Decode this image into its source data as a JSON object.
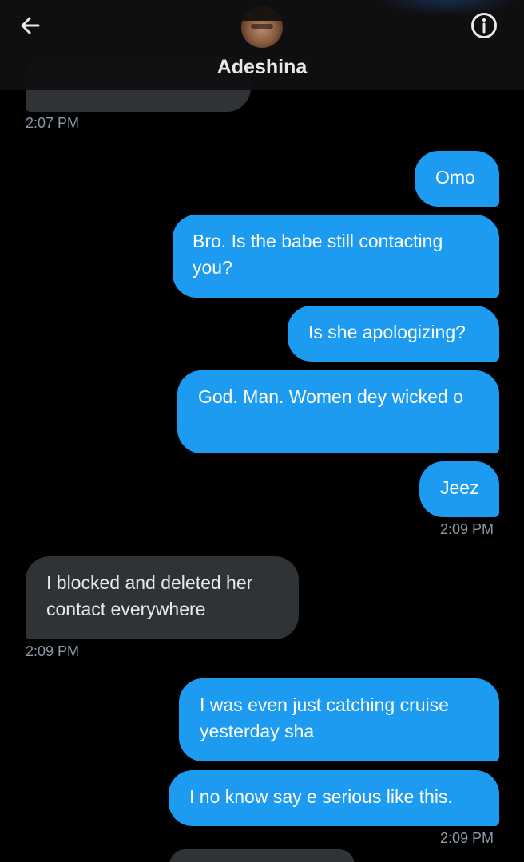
{
  "header": {
    "contact_name": "Adeshina",
    "back_icon": "arrow-left-icon",
    "info_icon": "info-icon"
  },
  "colors": {
    "outgoing_bubble": "#1d9bf0",
    "incoming_bubble": "#2f3336",
    "timestamp": "#8b98a5",
    "background": "#000000"
  },
  "messages": [
    {
      "direction": "in",
      "text": "",
      "partial": true
    },
    {
      "direction": "out",
      "text": "Omo"
    },
    {
      "direction": "out",
      "text": "Bro. Is the babe still contacting you?"
    },
    {
      "direction": "out",
      "text": "Is she apologizing?"
    },
    {
      "direction": "out",
      "text": "God. Man. Women dey wicked o"
    },
    {
      "direction": "out",
      "text": "Jeez"
    },
    {
      "direction": "in",
      "text": "I blocked and deleted her contact everywhere"
    },
    {
      "direction": "out",
      "text": "I was even just catching cruise yesterday sha"
    },
    {
      "direction": "out",
      "text": "I no know say e serious like this."
    }
  ],
  "timestamps": [
    "2:07 PM",
    "2:09 PM",
    "2:09 PM",
    "2:09 PM"
  ]
}
